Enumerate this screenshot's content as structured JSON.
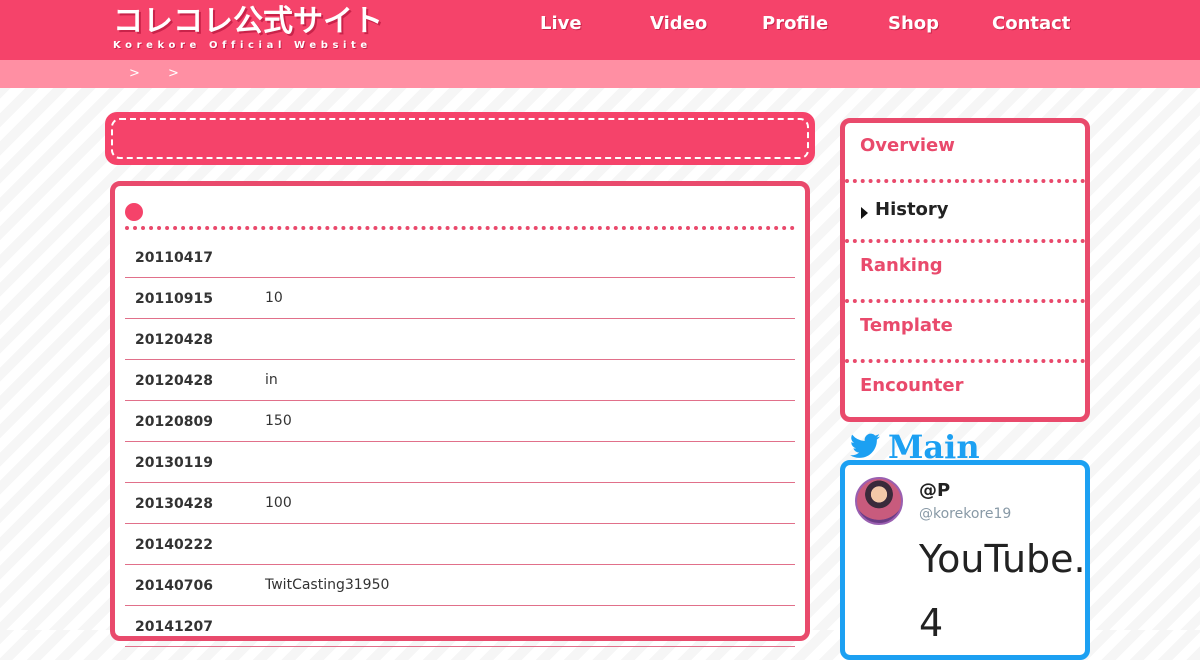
{
  "header": {
    "logo_jp": "コレコレ公式サイト",
    "logo_en": "Korekore Official Website",
    "nav": [
      {
        "label": "Live"
      },
      {
        "label": "Video"
      },
      {
        "label": "Profile"
      },
      {
        "label": "Shop"
      },
      {
        "label": "Contact"
      }
    ],
    "colors": {
      "bar": "#f5436a",
      "breadcrumb": "#ff8fa3",
      "accent": "#e94a6c"
    }
  },
  "breadcrumb": {
    "separator": ">"
  },
  "main": {
    "page_title": "",
    "section_heading": "",
    "history": [
      {
        "date": "20110417",
        "text": ""
      },
      {
        "date": "20110915",
        "text": "10"
      },
      {
        "date": "20120428",
        "text": ""
      },
      {
        "date": "20120428",
        "text": " in"
      },
      {
        "date": "20120809",
        "text": "150"
      },
      {
        "date": "20130119",
        "text": ""
      },
      {
        "date": "20130428",
        "text": "100"
      },
      {
        "date": "20140222",
        "text": ""
      },
      {
        "date": "20140706",
        "text": "TwitCasting31950"
      },
      {
        "date": "20141207",
        "text": ""
      }
    ]
  },
  "sidebar": {
    "menu": [
      {
        "label": "Overview",
        "active": false
      },
      {
        "label": "History",
        "active": true
      },
      {
        "label": "Ranking",
        "active": false
      },
      {
        "label": "Template",
        "active": false
      },
      {
        "label": "Encounter",
        "active": false
      }
    ],
    "twitter": {
      "heading": "Main",
      "name": "@P",
      "handle": "@korekore19",
      "text": "YouTube.4",
      "icon": "twitter-bird-icon",
      "color": "#1ca0f2"
    }
  }
}
